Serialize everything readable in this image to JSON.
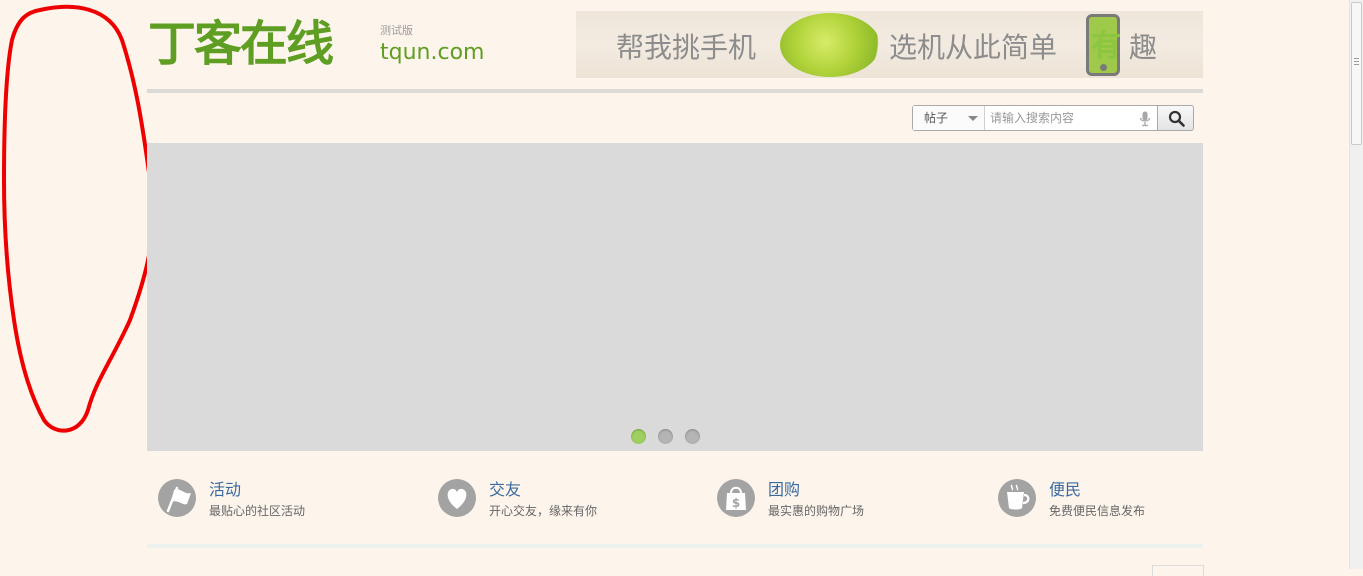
{
  "logo": {
    "name_cn": "丁客在线",
    "badge": "测试版",
    "domain": "tqun.com"
  },
  "banner": {
    "text_left": "帮我挑手机",
    "text_mid": "选机从此简单",
    "text_accent": "有",
    "text_end": "趣"
  },
  "search": {
    "type_value": "帖子",
    "placeholder": "请输入搜索内容",
    "icons": {
      "mic": "mic-icon",
      "button": "search-icon"
    }
  },
  "slider": {
    "dot_count": 3,
    "active_index": 0
  },
  "features": [
    {
      "title": "活动",
      "desc": "最贴心的社区活动",
      "icon": "flag-icon"
    },
    {
      "title": "交友",
      "desc": "开心交友，缘来有你",
      "icon": "heart-icon"
    },
    {
      "title": "团购",
      "desc": "最实惠的购物广场",
      "icon": "shopping-bag-icon"
    },
    {
      "title": "便民",
      "desc": "免费便民信息发布",
      "icon": "coffee-cup-icon"
    }
  ],
  "colors": {
    "page_bg": "#fdf5ec",
    "brand_green": "#5e9e22",
    "link_blue": "#3a6aa0",
    "annotation_red": "#ee0000",
    "dot_active": "#9fcf5f"
  }
}
